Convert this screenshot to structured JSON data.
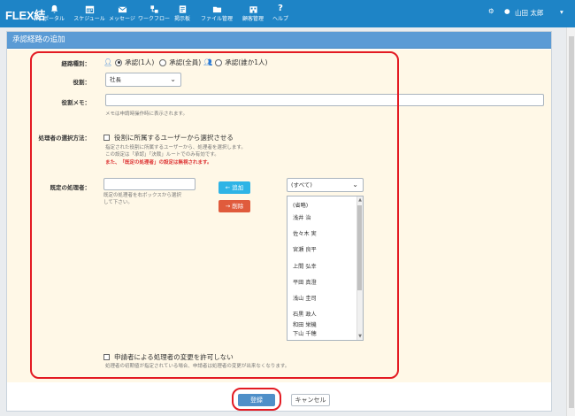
{
  "app": {
    "logo": "FLEX結",
    "nav": [
      {
        "label": "ポータル",
        "icon": "bell-icon"
      },
      {
        "label": "スケジュール",
        "icon": "calendar-icon"
      },
      {
        "label": "メッセージ",
        "icon": "envelope-icon"
      },
      {
        "label": "ワークフロー",
        "icon": "workflow-icon"
      },
      {
        "label": "掲示板",
        "icon": "board-icon"
      },
      {
        "label": "ファイル管理",
        "icon": "folder-icon"
      },
      {
        "label": "顧客管理",
        "icon": "customer-icon"
      },
      {
        "label": "ヘルプ",
        "icon": "help-icon"
      }
    ],
    "user_name": "山田 太郎"
  },
  "panel": {
    "title": "承認経路の追加"
  },
  "form": {
    "route_type": {
      "label": "経路種別：",
      "options": [
        "承認(1人)",
        "承認(全員)",
        "承認(誰か1人)"
      ],
      "selected": "承認(1人)"
    },
    "role": {
      "label": "役割：",
      "value": "社長"
    },
    "role_memo": {
      "label": "役割メモ：",
      "value": "",
      "help": "メモは申請時操作時に表示されます。"
    },
    "processor_method": {
      "label": "処理者の選択方法：",
      "checkbox_label": "役割に所属するユーザーから選択させる",
      "help1": "指定された役割に所属するユーザーから、処理者を選択します。",
      "help2": "この設定は「承認」「決裁」ルートでのみ有効です。",
      "help_red": "また、「既定の処理者」の設定は無視されます。"
    },
    "default_processor": {
      "label": "既定の処理者：",
      "value": "",
      "help1": "既定の処理者を右ボックスから選択",
      "help2": "して下さい。",
      "add_button": "追加",
      "delete_button": "削除",
      "filter_value": "(すべて)",
      "list": [
        "(省略)",
        "浅井 治",
        "佐々木 実",
        "宮瀬 良平",
        "上間 弘幸",
        "平田 真澄",
        "浅山 圭司",
        "石黒 政人",
        "和田 栄機",
        "下山 千穂"
      ]
    },
    "no_change": {
      "checkbox_label": "申請者による処理者の変更を許可しない",
      "help": "処理者の初期値が指定されている場合、申請者は処理者の変更が出来なくなります。"
    }
  },
  "footer": {
    "submit_label": "登録",
    "cancel_label": "キャンセル"
  },
  "colors": {
    "nav_bg": "#1e84c6",
    "panel_header": "#5b9bd5",
    "form_bg": "#fff8e7",
    "highlight": "#e31b23"
  }
}
